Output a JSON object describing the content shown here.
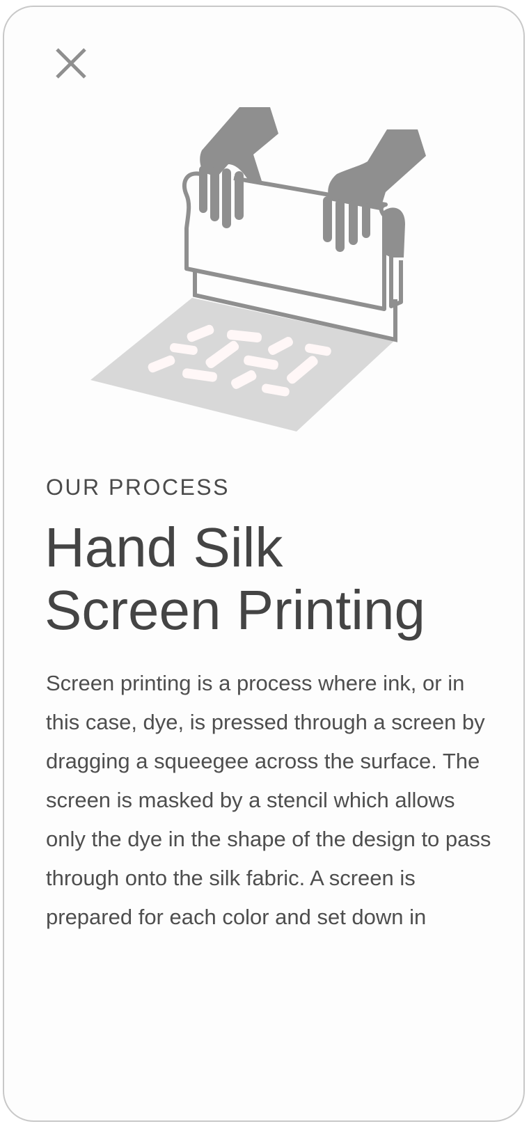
{
  "close": {
    "icon": "close-icon",
    "label": "Close"
  },
  "illustration": {
    "icon": "screen-printing-hands-illustration"
  },
  "colors": {
    "icon_gray": "#8f8f8f",
    "surface_gray": "#d8d8d8",
    "text_dark": "#444444",
    "card_border": "#c8c8c8"
  },
  "content": {
    "eyebrow": "OUR PROCESS",
    "title_line1": "Hand Silk",
    "title_line2": "Screen Printing",
    "body": "Screen printing is a process where ink, or in this case, dye, is pressed through a screen by dragging a squeegee across the surface. The screen is masked by a stencil which allows only the dye in the shape of the design to pass through onto the silk fabric. A screen is prepared for each color and set down in"
  }
}
